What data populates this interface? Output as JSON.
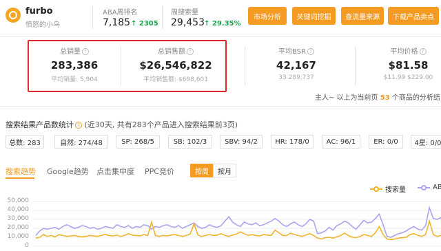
{
  "header": {
    "keyword": "furbo",
    "translation": "愤怒的小鸟",
    "aba_rank_label": "ABA周排名",
    "aba_rank_value": "7,185",
    "aba_rank_change": "↑ 2305",
    "weekly_search_label": "周搜索量",
    "weekly_search_value": "29,453",
    "weekly_search_change": "↑ 29.35%",
    "buttons": [
      "市场分析",
      "关键词挖掘",
      "查流量来源",
      "下载产品卖点"
    ]
  },
  "stats": [
    {
      "label": "总销量",
      "value": "283,386",
      "sub": "平均销量: 5,904"
    },
    {
      "label": "总销售额",
      "value": "$26,546,822",
      "sub": "平均销售额: $698,601"
    },
    {
      "label": "平均BSR",
      "value": "42,167",
      "sub": "33 289,737"
    },
    {
      "label": "平均价格",
      "value": "$81.58",
      "sub": "$11.99 $229.00"
    }
  ],
  "tips": {
    "prefix": "主人~ 以上为当前页 ",
    "count": "53",
    "suffix": " 个商品的分析结"
  },
  "section": {
    "title": "搜索结果产品数统计",
    "note": "(近30天, 共有283个产品进入搜索结果前3页)"
  },
  "tags": [
    "总数: 283",
    "自然: 274/48",
    "SP: 268/5",
    "SB: 102/3",
    "SBV: 94/2",
    "HR: 178/0",
    "AC: 96/1",
    "ER: 0/0",
    "4星: 0/0"
  ],
  "tabs": [
    "搜索趋势",
    "Google趋势",
    "点击集中度",
    "PPC竞价"
  ],
  "toggles": [
    "按周",
    "按月"
  ],
  "legend": [
    "搜索量",
    "AB"
  ],
  "colors": {
    "accent": "#f59a23",
    "up": "#1aa34a",
    "highlight": "#e0282e",
    "series_search": "#f0b429",
    "series_aba": "#a9a3f0"
  },
  "chart_data": {
    "type": "line",
    "yticks": [
      "50,000",
      "40,000",
      "30,000",
      "20,000",
      "10,000",
      "0"
    ],
    "ylim": [
      0,
      50000
    ],
    "grid": true,
    "legend_position": "top-right",
    "series": [
      {
        "name": "搜索量",
        "values": [
          9000,
          10000,
          13000,
          11000,
          12000,
          10500,
          13000,
          12000,
          11000,
          11500,
          12000,
          11000,
          10500,
          11000,
          12000,
          11500,
          11000,
          12000,
          13000,
          12000,
          11500,
          12500,
          11000,
          12000,
          14000,
          12500,
          12000,
          11500,
          13000,
          12000,
          27000,
          12000,
          11000,
          12000,
          11500,
          12500,
          13000,
          12000,
          11000,
          12000,
          13500,
          25000,
          12500,
          11000,
          12000,
          13000,
          12000,
          12500,
          14000,
          12000,
          11000,
          12500,
          13500,
          16000,
          14000,
          12000,
          13000,
          12000,
          11500,
          13000,
          12500,
          12000,
          18000,
          15000,
          12000,
          12000,
          14500,
          13000,
          12000,
          11000,
          12500,
          14000,
          12000,
          9000,
          8000,
          9500,
          10000,
          9000,
          10500,
          12000,
          14500,
          12000,
          10000,
          9500,
          11000,
          13000,
          12000,
          11000,
          15000,
          22000,
          13000,
          8000,
          7500,
          8000,
          9000,
          9500,
          10000,
          13000,
          14000,
          12000,
          11000,
          13000,
          28000,
          13000,
          11000,
          12000
        ]
      },
      {
        "name": "AB",
        "values": [
          12000,
          17000,
          20000,
          19000,
          20000,
          21000,
          19000,
          22000,
          24000,
          22000,
          20000,
          21000,
          23000,
          22000,
          20000,
          21000,
          19000,
          20000,
          22000,
          21000,
          20000,
          24000,
          22000,
          21000,
          23000,
          20000,
          22000,
          21000,
          24000,
          23000,
          19000,
          22000,
          21000,
          23000,
          24000,
          22000,
          21000,
          23000,
          20000,
          22000,
          24000,
          26000,
          22000,
          20000,
          21000,
          24000,
          22000,
          21000,
          23000,
          28000,
          33000,
          27000,
          24000,
          22000,
          27000,
          25000,
          24000,
          26000,
          23000,
          24000,
          26000,
          28000,
          31000,
          28000,
          24000,
          22000,
          25000,
          27000,
          24000,
          22000,
          25000,
          30000,
          28000,
          14000,
          15000,
          17000,
          21000,
          18000,
          23000,
          25000,
          28000,
          26000,
          22000,
          19000,
          24000,
          29000,
          26000,
          27000,
          31000,
          36000,
          24000,
          11000,
          10000,
          12000,
          14000,
          15000,
          17000,
          20000,
          22000,
          19000,
          18000,
          23000,
          43000,
          31000,
          30000,
          32000
        ]
      }
    ]
  }
}
